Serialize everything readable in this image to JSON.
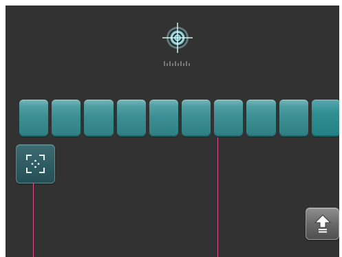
{
  "app": {
    "screen": "key-calibration-screen"
  },
  "toolbar": {
    "target_icon": "crosshair-target-icon",
    "ruler_icon": "tick-ruler-icon",
    "focus_icon": "focus-frame-icon",
    "up_icon": "upload-arrow-icon"
  },
  "keys": [
    {
      "name": "key-1"
    },
    {
      "name": "key-2"
    },
    {
      "name": "key-3"
    },
    {
      "name": "key-4"
    },
    {
      "name": "key-5"
    },
    {
      "name": "key-6"
    },
    {
      "name": "key-7"
    },
    {
      "name": "key-8"
    },
    {
      "name": "key-9"
    },
    {
      "name": "key-10"
    }
  ],
  "colors": {
    "background": "#333232",
    "teal_key": "#3e8f93",
    "guide_line": "#e0508f",
    "button_dark": "#244f55",
    "button_gray": "#666666"
  }
}
